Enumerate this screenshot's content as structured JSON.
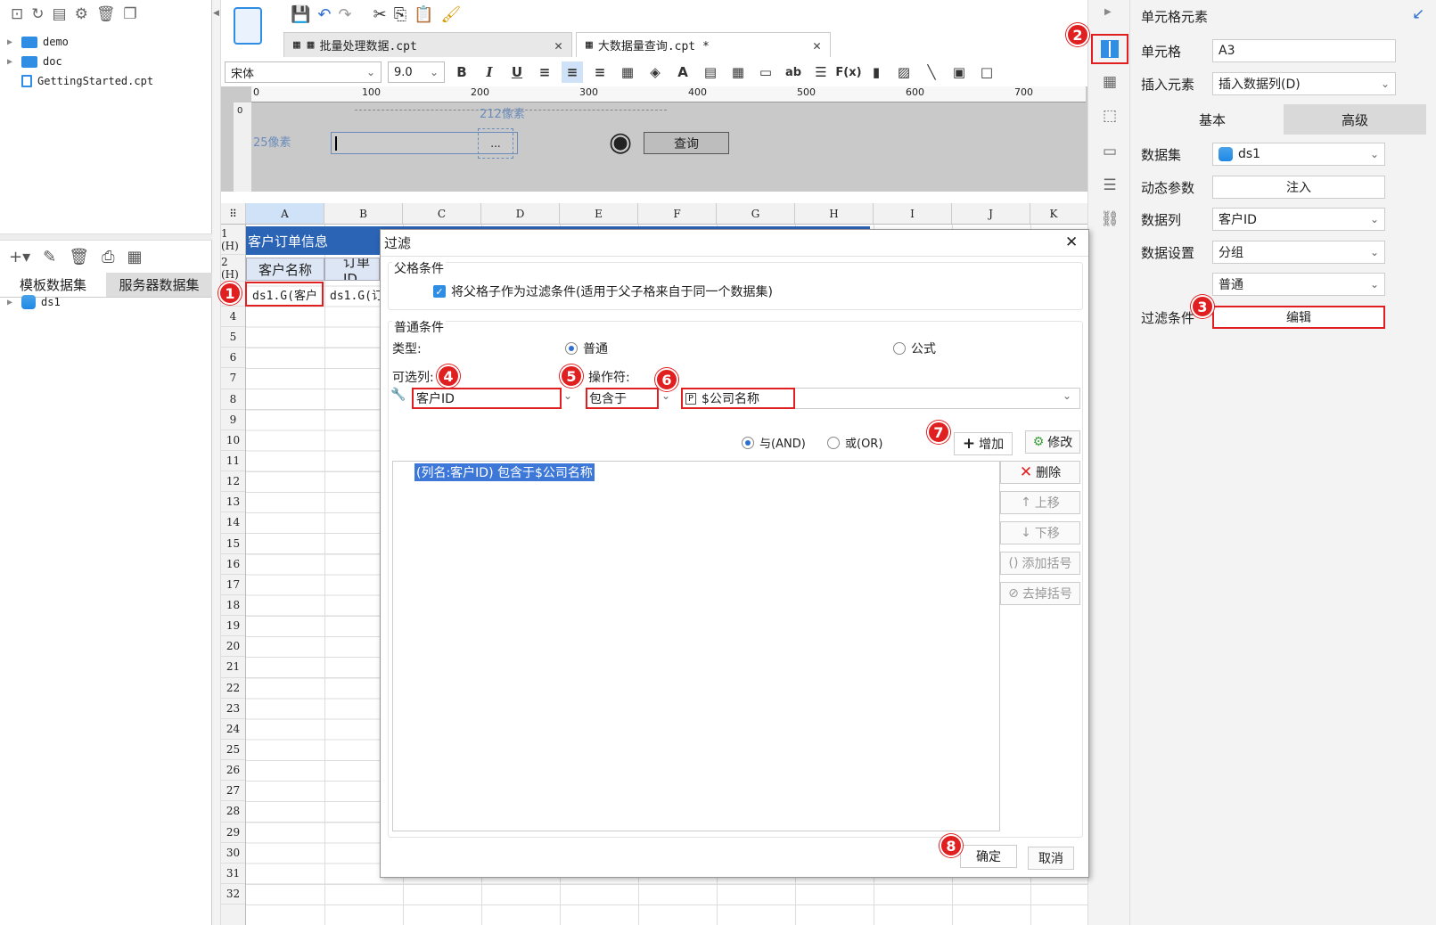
{
  "left_panel": {
    "tree": [
      {
        "label": "demo",
        "type": "folder"
      },
      {
        "label": "doc",
        "type": "folder"
      },
      {
        "label": "GettingStarted.cpt",
        "type": "file"
      }
    ],
    "dataset_tabs": [
      "模板数据集",
      "服务器数据集"
    ],
    "datasets": [
      "ds1"
    ]
  },
  "tabs": [
    {
      "label": "批量处理数据.cpt",
      "active": false
    },
    {
      "label": "大数据量查询.cpt *",
      "active": true
    }
  ],
  "format_bar": {
    "font": "宋体",
    "size": "9.0",
    "bold": "B",
    "italic": "I",
    "underline": "U"
  },
  "param_pane": {
    "ruler_ticks": [
      "0",
      "100",
      "200",
      "300",
      "400",
      "500",
      "600",
      "700"
    ],
    "vruler_tick": "0",
    "width_hint": "212像素",
    "height_hint": "25像素",
    "browse_button": "...",
    "query_button": "查询"
  },
  "grid": {
    "columns": [
      "A",
      "B",
      "C",
      "D",
      "E",
      "F",
      "G",
      "H",
      "I",
      "J",
      "K"
    ],
    "rows": [
      "1 (H)",
      "2 (H)",
      "3",
      "4",
      "5",
      "6",
      "7",
      "8",
      "9",
      "10",
      "11",
      "12",
      "13",
      "14",
      "15",
      "16",
      "17",
      "18",
      "19",
      "20",
      "21",
      "22",
      "23",
      "24",
      "25",
      "26",
      "27",
      "28",
      "29",
      "30",
      "31",
      "32"
    ],
    "row1_title": "客户订单信息",
    "header_a": "客户名称",
    "header_b": "订单ID",
    "cell_a3": "ds1.G(客户",
    "cell_b3": "ds1.G(订"
  },
  "right_panel": {
    "title": "单元格元素",
    "cell_label": "单元格",
    "cell_value": "A3",
    "insert_label": "插入元素",
    "insert_value": "插入数据列(D)",
    "tab_basic": "基本",
    "tab_advanced": "高级",
    "dataset_label": "数据集",
    "dataset_value": "ds1",
    "dyn_label": "动态参数",
    "dyn_button": "注入",
    "column_label": "数据列",
    "column_value": "客户ID",
    "setting_label": "数据设置",
    "setting_value": "分组",
    "setting_value2": "普通",
    "filter_label": "过滤条件",
    "filter_button": "编辑"
  },
  "dialog": {
    "title": "过滤",
    "parent_group": "父格条件",
    "parent_check": "将父格子作为过滤条件(适用于父子格来自于同一个数据集)",
    "normal_group": "普通条件",
    "type_label": "类型:",
    "type_normal": "普通",
    "type_formula": "公式",
    "col_label": "可选列:",
    "op_label": "操作符:",
    "col_value": "客户ID",
    "op_value": "包含于",
    "param_value": "$公司名称",
    "and_label": "与(AND)",
    "or_label": "或(OR)",
    "add_button": "增加",
    "modify_button": "修改",
    "delete_button": "删除",
    "up_button": "上移",
    "down_button": "下移",
    "add_bracket": "添加括号",
    "remove_bracket": "去掉括号",
    "condition_item": "(列名:客户ID) 包含于$公司名称",
    "ok_button": "确定",
    "cancel_button": "取消"
  },
  "badges": [
    "1",
    "2",
    "3",
    "4",
    "5",
    "6",
    "7",
    "8"
  ],
  "colors": {
    "accent": "#2f8de4",
    "highlight": "#e02020",
    "header_blue": "#2b63b5"
  }
}
